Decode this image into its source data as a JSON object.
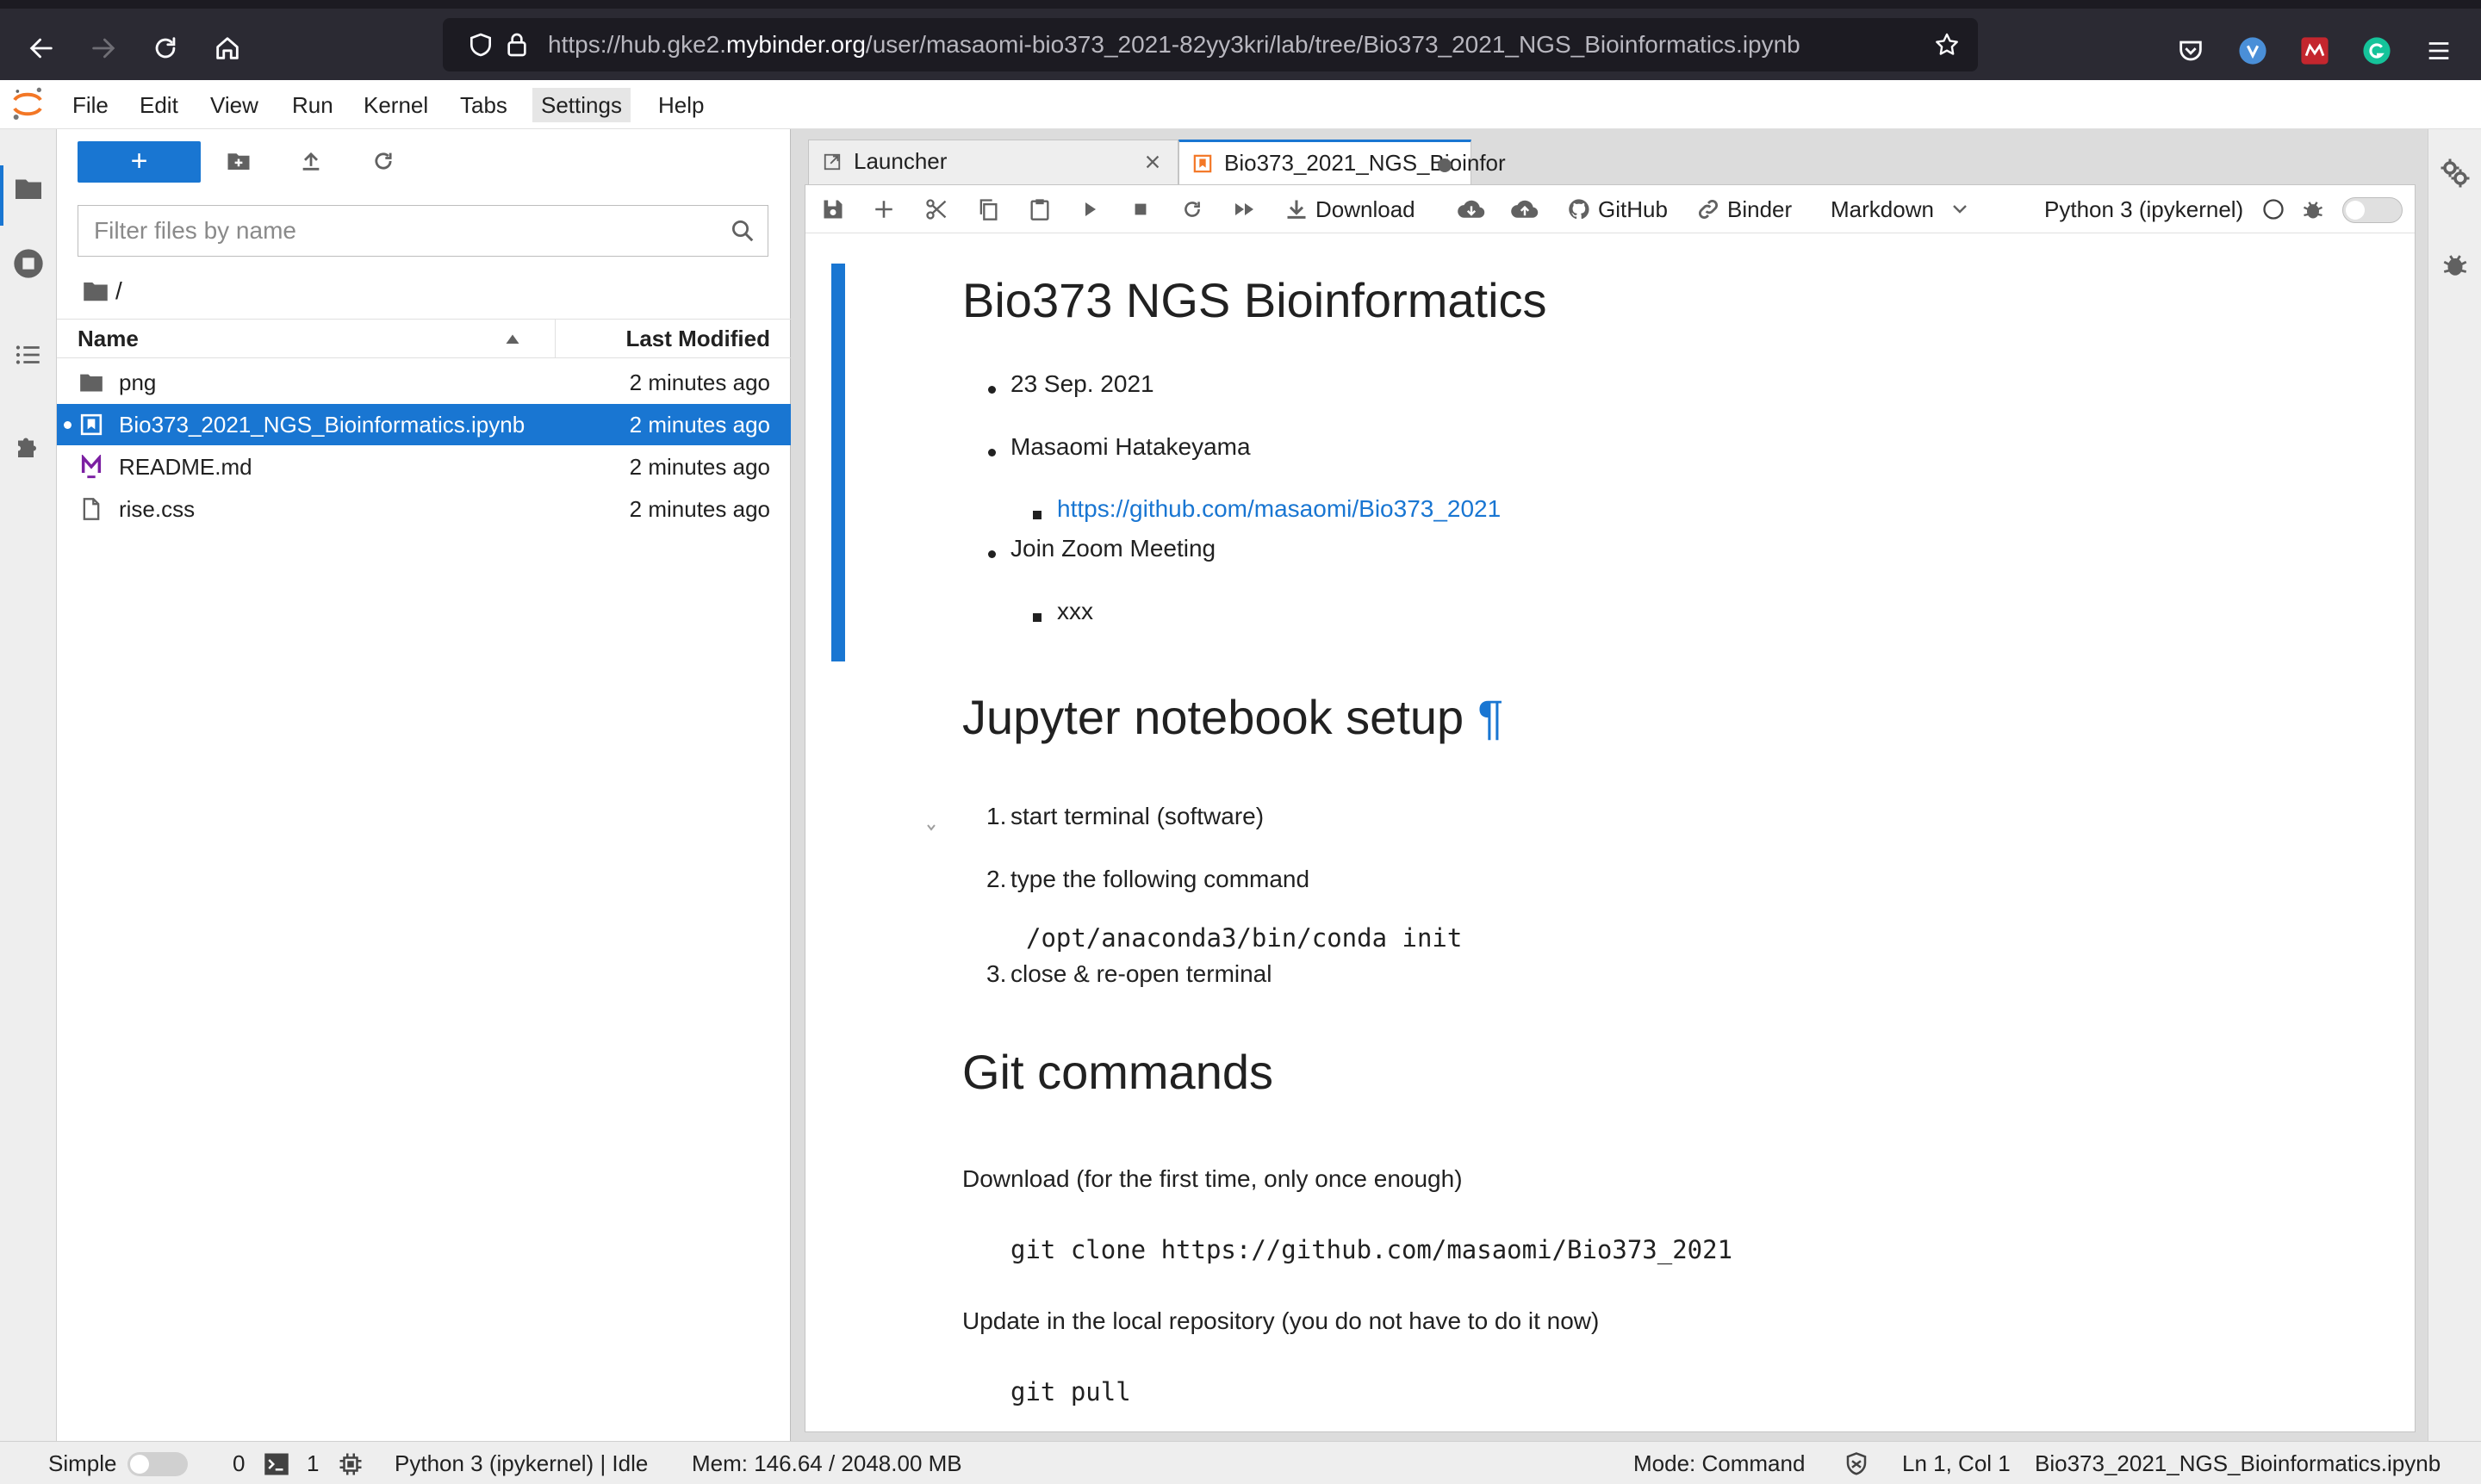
{
  "browser": {
    "url_prefix": "https://hub.gke2.",
    "url_host": "mybinder.org",
    "url_path": "/user/masaomi-bio373_2021-82yy3kri/lab/tree/Bio373_2021_NGS_Bioinformatics.ipynb",
    "extension_icons": [
      "pocket-icon",
      "vivaldi-icon",
      "mendeley-icon",
      "grammarly-icon",
      "menu-icon"
    ],
    "colors": {
      "chrome_bg": "#2b2a33",
      "url_bg": "#1c1b22"
    }
  },
  "menubar": {
    "items": [
      "File",
      "Edit",
      "View",
      "Run",
      "Kernel",
      "Tabs",
      "Settings",
      "Help"
    ],
    "active": "Settings"
  },
  "filebrowser": {
    "new_button": "+",
    "filter_placeholder": "Filter files by name",
    "breadcrumb": "/",
    "header_name": "Name",
    "header_modified": "Last Modified",
    "files": [
      {
        "name": "png",
        "modified": "2 minutes ago",
        "icon": "folder-icon",
        "selected": false
      },
      {
        "name": "Bio373_2021_NGS_Bioinformatics.ipynb",
        "modified": "2 minutes ago",
        "icon": "notebook-icon",
        "selected": true
      },
      {
        "name": "README.md",
        "modified": "2 minutes ago",
        "icon": "markdown-icon",
        "selected": false
      },
      {
        "name": "rise.css",
        "modified": "2 minutes ago",
        "icon": "file-icon",
        "selected": false
      }
    ]
  },
  "tabs": [
    {
      "label": "Launcher",
      "active": false
    },
    {
      "label": "Bio373_2021_NGS_Bioinfor",
      "active": true
    }
  ],
  "notebook_toolbar": {
    "download": "Download",
    "github": "GitHub",
    "binder": "Binder",
    "cell_type": "Markdown",
    "kernel": "Python 3 (ipykernel)"
  },
  "notebook": {
    "h1_a": "Bio373 NGS Bioinformatics",
    "date": "23 Sep. 2021",
    "author": "Masaomi Hatakeyama",
    "repo_link": "https://github.com/masaomi/Bio373_2021",
    "zoom": "Join Zoom Meeting",
    "zoom_id": "xxx",
    "h1_b": "Jupyter notebook setup",
    "anchor": "¶",
    "steps": [
      "start terminal (software)",
      "type the following command",
      "close & re-open terminal"
    ],
    "step_numbers": [
      "1.",
      "2.",
      "3."
    ],
    "conda_cmd": "/opt/anaconda3/bin/conda init",
    "h1_c": "Git commands",
    "download_text": "Download (for the first time, only once enough)",
    "clone_cmd": "git clone https://github.com/masaomi/Bio373_2021",
    "update_text": "Update in the local repository (you do not have to do it now)",
    "pull_cmd": "git pull"
  },
  "status": {
    "mode_label": "Simple",
    "terminals": "0",
    "kernels": "1",
    "kernel_status": "Python 3 (ipykernel) | Idle",
    "memory": "Mem: 146.64 / 2048.00 MB",
    "mode": "Mode: Command",
    "cursor": "Ln 1, Col 1",
    "filename": "Bio373_2021_NGS_Bioinformatics.ipynb"
  },
  "colors": {
    "accent": "#1976d2",
    "selected_row": "#1976d2",
    "sidebar_bg": "#eeeeee"
  }
}
